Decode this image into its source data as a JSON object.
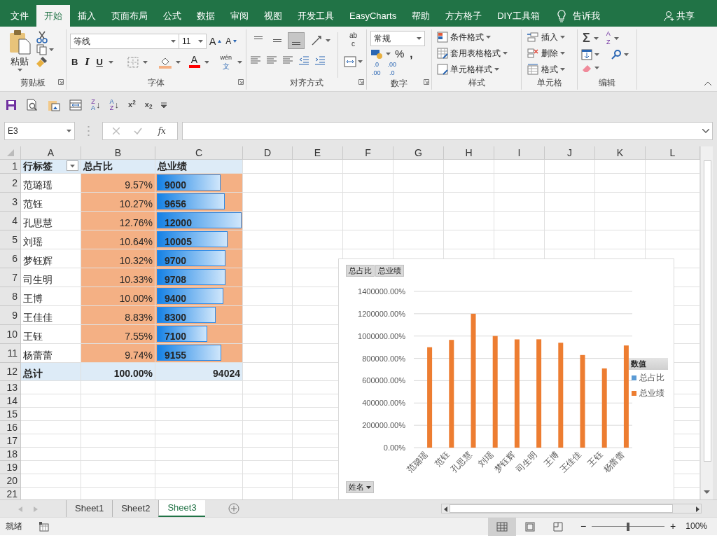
{
  "ribbon_tabs": [
    {
      "label": "文件",
      "selected": false
    },
    {
      "label": "开始",
      "selected": true
    },
    {
      "label": "插入",
      "selected": false
    },
    {
      "label": "页面布局",
      "selected": false
    },
    {
      "label": "公式",
      "selected": false
    },
    {
      "label": "数据",
      "selected": false
    },
    {
      "label": "审阅",
      "selected": false
    },
    {
      "label": "视图",
      "selected": false
    },
    {
      "label": "开发工具",
      "selected": false
    },
    {
      "label": "EasyCharts",
      "selected": false
    },
    {
      "label": "帮助",
      "selected": false
    },
    {
      "label": "方方格子",
      "selected": false
    },
    {
      "label": "DIY工具箱",
      "selected": false
    }
  ],
  "tell_me": "告诉我",
  "share": "共享",
  "clipboard": {
    "label": "剪贴板",
    "paste": "粘贴"
  },
  "font": {
    "label": "字体",
    "font_name": "等线",
    "font_size": "11",
    "grow": "A",
    "shrink": "A",
    "bold": "B",
    "italic": "I",
    "underline": "U",
    "font_color": "A",
    "phonetic": [
      "wén",
      "文"
    ]
  },
  "alignment": {
    "label": "对齐方式",
    "vertical": [
      {
        "selected": false
      },
      {
        "selected": false
      },
      {
        "selected": true
      }
    ],
    "wrap": [
      "ab",
      "c"
    ]
  },
  "number": {
    "label": "数字",
    "format": "常规",
    "percent": "%",
    "comma": ",",
    "increase_decimal": [
      ".0",
      ".00"
    ],
    "decrease_decimal": [
      ".00",
      ".0"
    ]
  },
  "styles": {
    "label": "样式",
    "commands": [
      "条件格式",
      "套用表格格式",
      "单元格样式"
    ]
  },
  "cells": {
    "label": "单元格",
    "commands": [
      "插入",
      "删除",
      "格式"
    ]
  },
  "editing": {
    "label": "编辑",
    "autosum": "Σ",
    "sort_filter": [
      "A",
      "Z"
    ]
  },
  "quick_access": {
    "sort_descending": [
      "Z",
      "A",
      "↓"
    ],
    "sort_ascending": [
      "A",
      "Z",
      "↓"
    ],
    "superscript": "x$^{2}$",
    "subscript": "x$_{2}$"
  },
  "formula_bar": {
    "name_box": "E3",
    "function_label": "fx"
  },
  "sheet": {
    "columns": [
      "A",
      "B",
      "C",
      "D",
      "E",
      "F",
      "G",
      "H",
      "I",
      "J",
      "K",
      "L"
    ],
    "rows": [
      "1",
      "2",
      "3",
      "4",
      "5",
      "6",
      "7",
      "8",
      "9",
      "10",
      "11",
      "12",
      "13",
      "14",
      "15",
      "16",
      "17",
      "18",
      "19",
      "20",
      "21"
    ],
    "header": [
      "行标签",
      "总占比",
      "总业绩"
    ],
    "data": [
      {
        "name": "范璐瑶",
        "share": "9.57%",
        "total": "9000",
        "level": 0.75
      },
      {
        "name": "范钰",
        "share": "10.27%",
        "total": "9656",
        "level": 0.805
      },
      {
        "name": "孔思慧",
        "share": "12.76%",
        "total": "12000",
        "level": 1
      },
      {
        "name": "刘瑶",
        "share": "10.64%",
        "total": "10005",
        "level": 0.834
      },
      {
        "name": "梦钰辉",
        "share": "10.32%",
        "total": "9700",
        "level": 0.808
      },
      {
        "name": "司生明",
        "share": "10.33%",
        "total": "9708",
        "level": 0.809
      },
      {
        "name": "王博",
        "share": "10.00%",
        "total": "9400",
        "level": 0.783
      },
      {
        "name": "王佳佳",
        "share": "8.83%",
        "total": "8300",
        "level": 0.692
      },
      {
        "name": "王钰",
        "share": "7.55%",
        "total": "7100",
        "level": 0.592
      },
      {
        "name": "杨蕾蕾",
        "share": "9.74%",
        "total": "9155",
        "level": 0.763
      }
    ],
    "total_row": [
      "总计",
      "100.00%",
      "94024"
    ]
  },
  "chart": {
    "field_buttons": [
      "总占比",
      "总业绩"
    ],
    "axis_field": "姓名",
    "legend_title": "数值",
    "chart_data": {
      "type": "bar",
      "grid": true,
      "categories": [
        "范璐瑶",
        "范钰",
        "孔思慧",
        "刘瑶",
        "梦钰辉",
        "司生明",
        "王博",
        "王佳佳",
        "王钰",
        "杨蕾蕾"
      ],
      "series": [
        {
          "name": "总占比",
          "color": "#5b9bd5",
          "values": [
            0,
            0,
            0,
            0,
            0,
            0,
            0,
            0,
            0,
            0
          ]
        },
        {
          "name": "总业绩",
          "color": "#ed7d31",
          "values": [
            9000,
            9656,
            12000,
            10005,
            9700,
            9708,
            9400,
            8300,
            7100,
            9155
          ]
        }
      ],
      "ylim": [
        0,
        14000
      ],
      "yticks": [
        {
          "value": 0,
          "label": "0.00%"
        },
        {
          "value": 2000,
          "label": "200000.00%"
        },
        {
          "value": 4000,
          "label": "400000.00%"
        },
        {
          "value": 6000,
          "label": "600000.00%"
        },
        {
          "value": 8000,
          "label": "800000.00%"
        },
        {
          "value": 10000,
          "label": "1000000.00%"
        },
        {
          "value": 12000,
          "label": "1200000.00%"
        },
        {
          "value": 14000,
          "label": "1400000.00%"
        }
      ]
    }
  },
  "sheet_tabs": [
    {
      "label": "Sheet1",
      "selected": false
    },
    {
      "label": "Sheet2",
      "selected": false
    },
    {
      "label": "Sheet3",
      "selected": true
    }
  ],
  "status_bar": {
    "text": "就绪",
    "view_buttons": [
      {
        "selected": true
      },
      {
        "selected": false
      },
      {
        "selected": false
      }
    ],
    "zoom_out": "−",
    "zoom_in": "+",
    "zoom": {
      "level": 0.5
    },
    "zoom_label": "100%"
  }
}
